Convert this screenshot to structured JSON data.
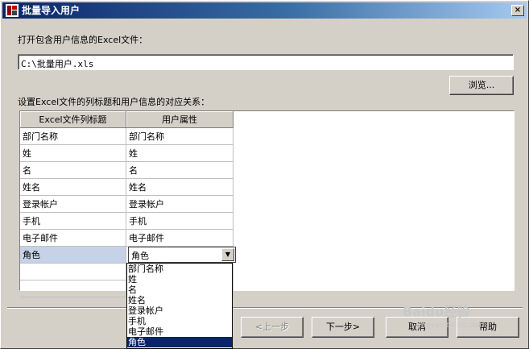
{
  "window": {
    "title": "批量导入用户",
    "close_symbol": "×"
  },
  "file_section": {
    "label": "打开包含用户信息的Excel文件：",
    "path_value": "C:\\批量用户.xls",
    "browse_label": "浏览..."
  },
  "mapping_section": {
    "label": "设置Excel文件的列标题和用户信息的对应关系：",
    "columns": [
      "Excel文件列标题",
      "用户属性"
    ],
    "rows": [
      {
        "excel": "部门名称",
        "attr": "部门名称"
      },
      {
        "excel": "姓",
        "attr": "姓"
      },
      {
        "excel": "名",
        "attr": "名"
      },
      {
        "excel": "姓名",
        "attr": "姓名"
      },
      {
        "excel": "登录帐户",
        "attr": "登录帐户"
      },
      {
        "excel": "手机",
        "attr": "手机"
      },
      {
        "excel": "电子邮件",
        "attr": "电子邮件"
      },
      {
        "excel": "角色",
        "attr": "角色"
      }
    ],
    "combo_value": "角色",
    "dropdown_options": [
      "部门名称",
      "姓",
      "名",
      "姓名",
      "登录帐户",
      "手机",
      "电子邮件",
      "角色"
    ],
    "dropdown_selected_index": 7
  },
  "footer": {
    "prev_label": "<上一步",
    "next_label": "下一步>",
    "cancel_label": "取消",
    "help_label": "帮助"
  },
  "watermark": {
    "brand": "Baidu经验",
    "url": "jingyan.baidu.com"
  },
  "colors": {
    "title_bar": "#0a246a",
    "selection": "#0a246a",
    "row_highlight": "#c6d3e6",
    "face": "#d4d0c8"
  }
}
